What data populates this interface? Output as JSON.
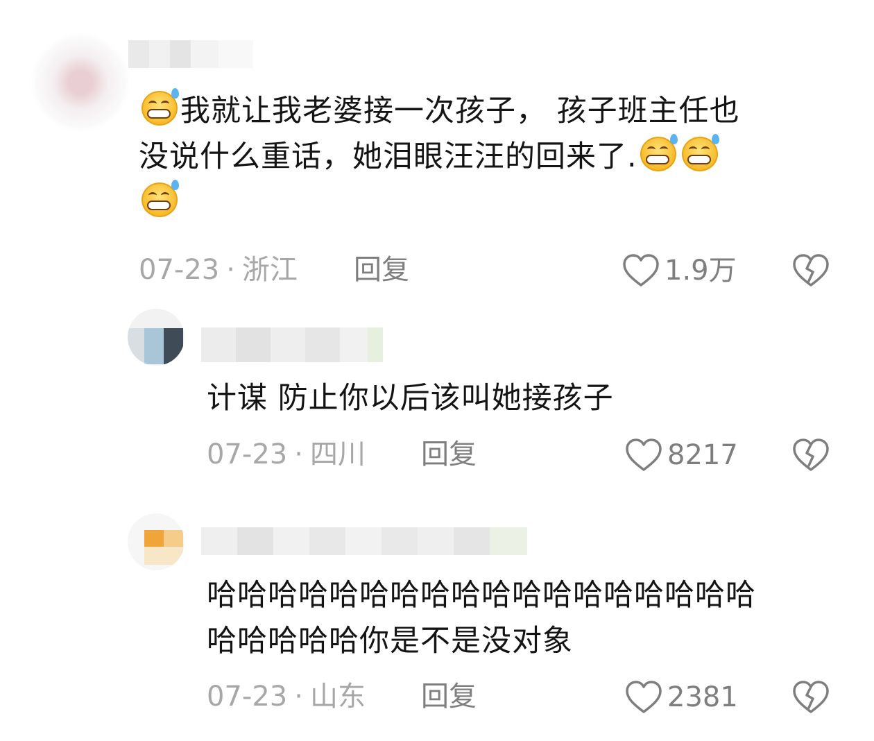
{
  "comments": [
    {
      "text_line1": "我就让我老婆接一次孩子， 孩子班主任也",
      "text_line2": "没说什么重话，她泪眼汪汪的回来了.",
      "date": "07-23",
      "location": "浙江",
      "reply_label": "回复",
      "likes": "1.9万"
    },
    {
      "text_line1": "计谋 防止你以后该叫她接孩子",
      "date": "07-23",
      "location": "四川",
      "reply_label": "回复",
      "likes": "8217"
    },
    {
      "text_line1": "哈哈哈哈哈哈哈哈哈哈哈哈哈哈哈哈哈哈",
      "text_line2": "哈哈哈哈哈你是不是没对象",
      "date": "07-23",
      "location": "山东",
      "reply_label": "回复",
      "likes": "2381"
    }
  ],
  "separator": "·",
  "icons": {
    "emoji": "sweat-grin-emoji",
    "like": "heart-outline-icon",
    "dislike": "broken-heart-icon"
  },
  "colors": {
    "text": "#141414",
    "meta": "#a7a7a7",
    "action": "#7e7e7e",
    "emoji_face": "#f7b824",
    "emoji_drop": "#5bb3f0"
  }
}
